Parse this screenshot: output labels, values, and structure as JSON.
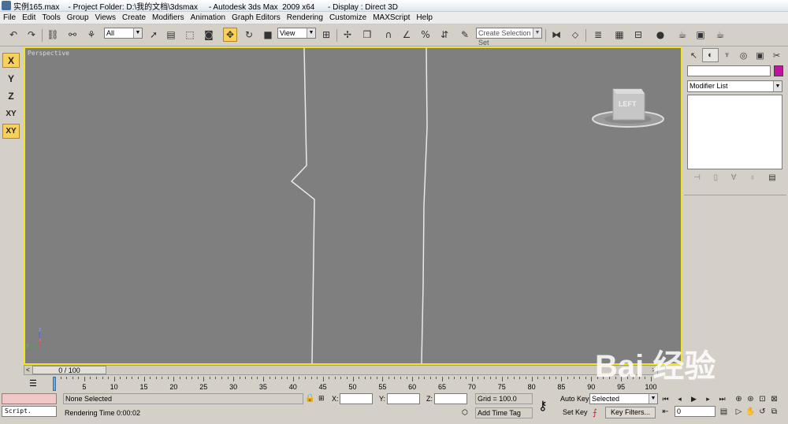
{
  "titlebar": {
    "title": "实例165.max    - Project Folder: D:\\我的文档\\3dsmax     - Autodesk 3ds Max  2009 x64      - Display : Direct 3D"
  },
  "menu": [
    "File",
    "Edit",
    "Tools",
    "Group",
    "Views",
    "Create",
    "Modifiers",
    "Animation",
    "Graph Editors",
    "Rendering",
    "Customize",
    "MAXScript",
    "Help"
  ],
  "toolbar": {
    "selection_filter": "All",
    "reference_coord": "View",
    "named_selection": "Create Selection Set",
    "icons": [
      "undo-icon",
      "redo-icon",
      "select-link-icon",
      "unlink-icon",
      "bind-space-warp-icon",
      "select-object-icon",
      "select-by-name-icon",
      "rect-region-icon",
      "window-crossing-icon",
      "move-icon",
      "rotate-icon",
      "scale-icon",
      "pivot-icon",
      "manipulate-icon",
      "keyboard-shortcut-icon",
      "snap-3d-icon",
      "angle-snap-icon",
      "percent-snap-icon",
      "spinner-snap-icon",
      "edit-named-sel-icon",
      "mirror-icon",
      "align-icon",
      "layer-manager-icon",
      "curve-editor-icon",
      "schematic-view-icon",
      "material-editor-icon",
      "render-setup-icon",
      "render-frame-icon",
      "quick-render-icon"
    ]
  },
  "axis_constraints": [
    "X",
    "Y",
    "Z",
    "XY",
    "XY"
  ],
  "viewport": {
    "label": "Perspective",
    "viewcube_label": "LEFT",
    "gizmo_labels": {
      "z": "z",
      "y": "y",
      "x": "x"
    }
  },
  "command_panel": {
    "tabs": [
      "create-tab-icon",
      "modify-tab-icon",
      "hierarchy-tab-icon",
      "motion-tab-icon",
      "display-tab-icon",
      "utilities-tab-icon"
    ],
    "object_name": "",
    "object_color": "#c0119f",
    "modifier_list": "Modifier List"
  },
  "timeline": {
    "current": "0 / 100",
    "left_arrow": "<",
    "right_arrow": ">",
    "ticks": [
      0,
      5,
      10,
      15,
      20,
      25,
      30,
      35,
      40,
      45,
      50,
      55,
      60,
      65,
      70,
      75,
      80,
      85,
      90,
      95,
      100
    ]
  },
  "status": {
    "selection": "None Selected",
    "render_time": "Rendering Time  0:00:02",
    "x_label": "X:",
    "y_label": "Y:",
    "z_label": "Z:",
    "x_value": "",
    "y_value": "",
    "z_value": "",
    "grid": "Grid = 100.0",
    "add_time_tag": "Add Time Tag",
    "auto_key": "Auto Key",
    "set_key": "Set Key",
    "selected": "Selected",
    "key_filters": "Key Filters...",
    "frame": "0",
    "script": "Script."
  },
  "watermark": "Bai 经验"
}
